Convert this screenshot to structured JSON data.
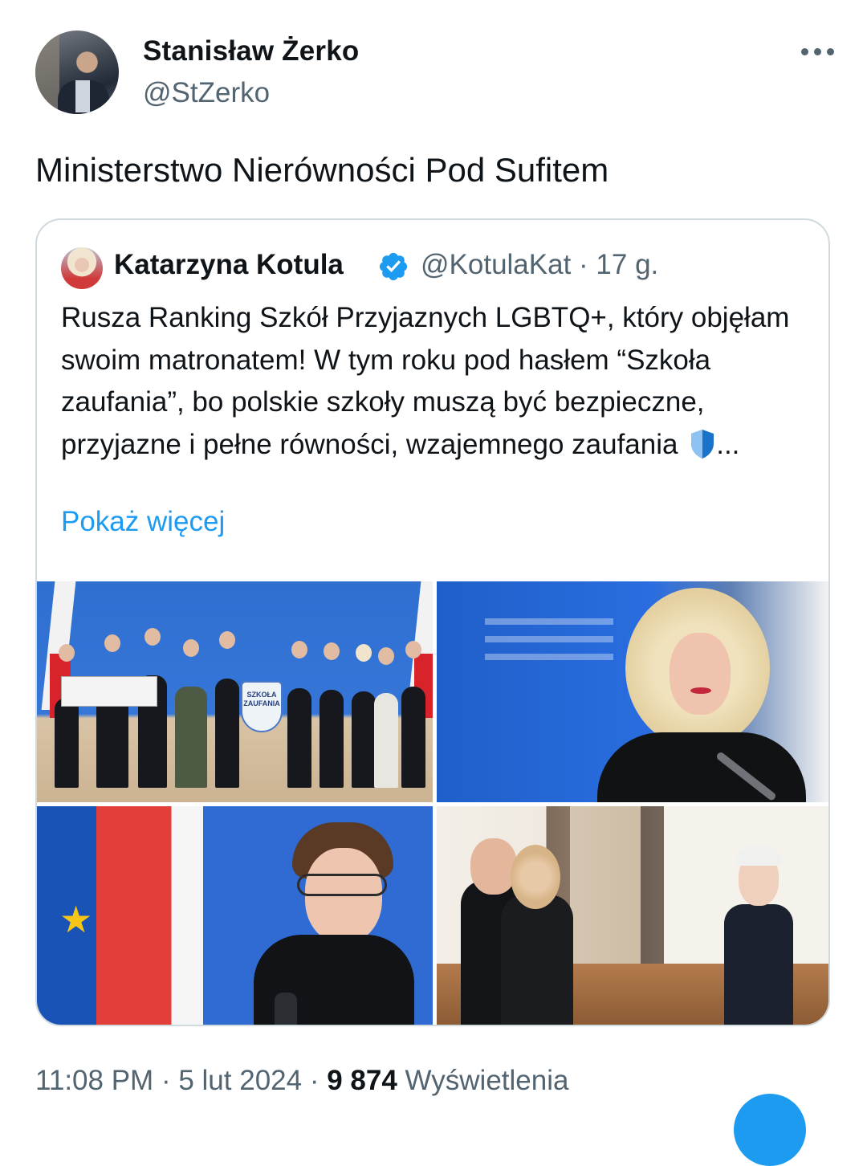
{
  "tweet": {
    "author": {
      "display_name": "Stanisław Żerko",
      "handle": "@StZerko"
    },
    "text": "Ministerstwo Nierówności Pod Sufitem",
    "meta": {
      "time": "11:08 PM",
      "sep": "·",
      "date": "5 lut 2024",
      "views_count": "9 874",
      "views_label": "Wyświetlenia"
    }
  },
  "quoted": {
    "display_name": "Katarzyna Kotula",
    "handle_and_time": "@KotulaKat · 17 g.",
    "text": "Rusza Ranking Szkół Przyjaznych LGBTQ+, który objęłam swoim matronatem! W tym roku pod hasłem “Szkoła zaufania”, bo polskie szkoły muszą być bezpieczne, przyjazne i pełne równości, wzajemnego zaufania",
    "ellipsis": "...",
    "show_more": "Pokaż więcej",
    "images": {
      "sign_text": "SZKOŁA ZAUFANIA"
    }
  },
  "colors": {
    "accent": "#1d9bf0",
    "secondary_text": "#536471",
    "border": "#cfd9de"
  },
  "icons": {
    "more": "more-horizontal-icon",
    "verified": "verified-badge-icon",
    "shield": "blue-shield-emoji"
  }
}
